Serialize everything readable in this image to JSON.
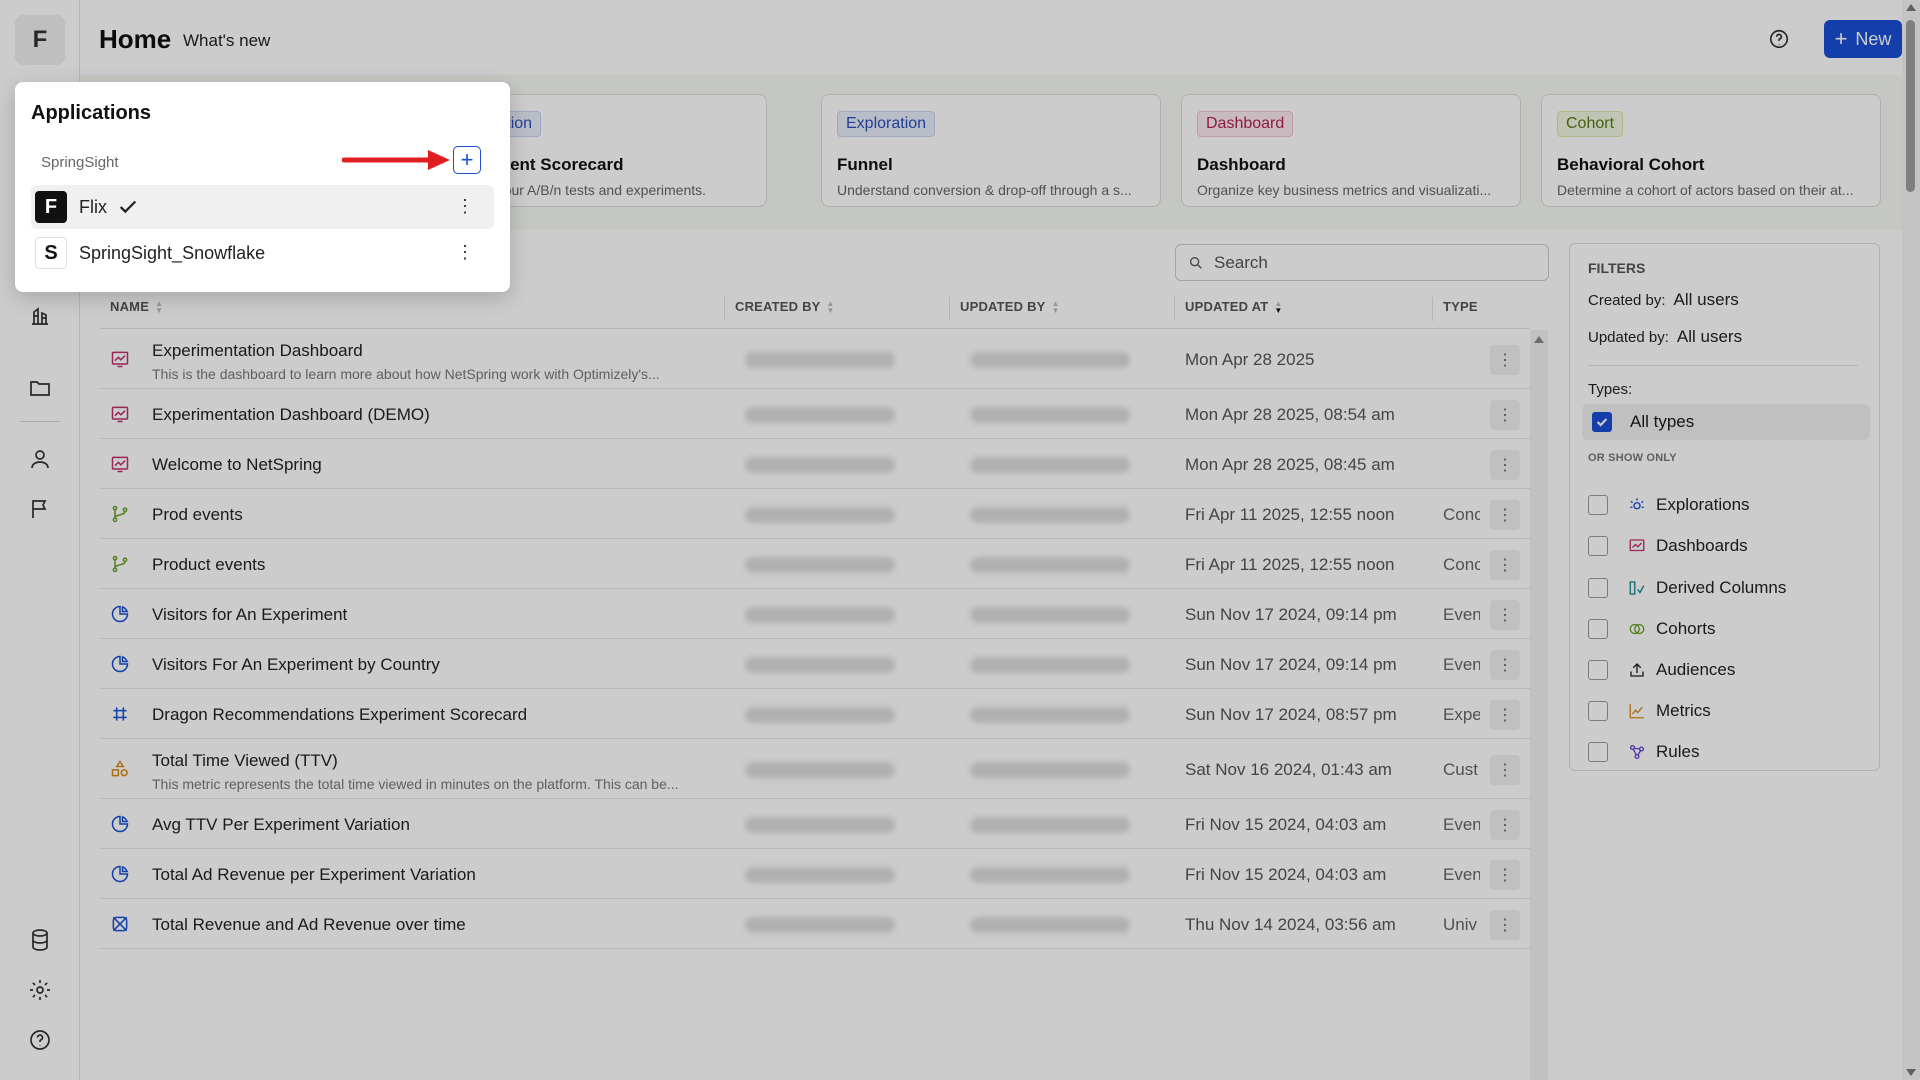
{
  "rail": {
    "logo_letter": "F",
    "icons": [
      "library-icon",
      "folder-icon",
      "user-icon",
      "flag-icon",
      "database-icon",
      "settings-icon",
      "help-icon"
    ]
  },
  "header": {
    "title": "Home",
    "subtitle": "What's new",
    "new_button": "New"
  },
  "templates": [
    {
      "badge": "Exploration",
      "badge_style": "explore",
      "title": "Experiment Scorecard",
      "desc": "Analyze your A/B/n tests and experiments."
    },
    {
      "badge": "Exploration",
      "badge_style": "explore",
      "title": "Funnel",
      "desc": "Understand conversion & drop-off through a s..."
    },
    {
      "badge": "Dashboard",
      "badge_style": "dash",
      "title": "Dashboard",
      "desc": "Organize key business metrics and visualizati..."
    },
    {
      "badge": "Cohort",
      "badge_style": "cohort",
      "title": "Behavioral Cohort",
      "desc": "Determine a cohort of actors based on their at..."
    }
  ],
  "search": {
    "placeholder": "Search"
  },
  "table": {
    "columns": {
      "name": "NAME",
      "created_by": "CREATED BY",
      "updated_by": "UPDATED BY",
      "updated_at": "UPDATED AT",
      "type": "TYPE"
    },
    "rows": [
      {
        "icon": "dashboard-icon",
        "name": "Experimentation Dashboard",
        "desc": "This is the dashboard to learn more about how NetSpring work with Optimizely's...",
        "updated_at": "Mon Apr 28 2025",
        "type": ""
      },
      {
        "icon": "dashboard-icon",
        "name": "Experimentation Dashboard (DEMO)",
        "desc": "",
        "updated_at": "Mon Apr 28 2025, 08:54 am",
        "type": ""
      },
      {
        "icon": "dashboard-icon",
        "name": "Welcome to NetSpring",
        "desc": "",
        "updated_at": "Mon Apr 28 2025, 08:45 am",
        "type": ""
      },
      {
        "icon": "branch-icon",
        "name": "Prod events",
        "desc": "",
        "updated_at": "Fri Apr 11 2025, 12:55 noon",
        "type": "Conc"
      },
      {
        "icon": "branch-icon",
        "name": "Product events",
        "desc": "",
        "updated_at": "Fri Apr 11 2025, 12:55 noon",
        "type": "Conc"
      },
      {
        "icon": "pie-chart-icon",
        "name": "Visitors for An Experiment",
        "desc": "",
        "updated_at": "Sun Nov 17 2024, 09:14 pm",
        "type": "Even"
      },
      {
        "icon": "pie-chart-icon",
        "name": "Visitors For An Experiment by Country",
        "desc": "",
        "updated_at": "Sun Nov 17 2024, 09:14 pm",
        "type": "Even"
      },
      {
        "icon": "scorecard-icon",
        "name": "Dragon Recommendations Experiment Scorecard",
        "desc": "",
        "updated_at": "Sun Nov 17 2024, 08:57 pm",
        "type": "Expe"
      },
      {
        "icon": "shapes-icon",
        "name": "Total Time Viewed (TTV)",
        "desc": "This metric represents the total time viewed in minutes on the platform. This can be...",
        "updated_at": "Sat Nov 16 2024, 01:43 am",
        "type": "Cust"
      },
      {
        "icon": "pie-chart-icon",
        "name": "Avg TTV Per Experiment Variation",
        "desc": "",
        "updated_at": "Fri Nov 15 2024, 04:03 am",
        "type": "Even"
      },
      {
        "icon": "pie-chart-icon",
        "name": "Total Ad Revenue per Experiment Variation",
        "desc": "",
        "updated_at": "Fri Nov 15 2024, 04:03 am",
        "type": "Even"
      },
      {
        "icon": "atom-icon",
        "name": "Total Revenue and Ad Revenue over time",
        "desc": "",
        "updated_at": "Thu Nov 14 2024, 03:56 am",
        "type": "Univ"
      }
    ]
  },
  "filters": {
    "title": "FILTERS",
    "created_by_label": "Created by:",
    "created_by_value": "All users",
    "updated_by_label": "Updated by:",
    "updated_by_value": "All users",
    "types_label": "Types:",
    "all_types": "All types",
    "or_show_only": "OR SHOW ONLY",
    "options": [
      {
        "label": "Explorations",
        "icon": "exploration-icon"
      },
      {
        "label": "Dashboards",
        "icon": "dashboard-icon"
      },
      {
        "label": "Derived Columns",
        "icon": "derived-column-icon"
      },
      {
        "label": "Cohorts",
        "icon": "cohort-icon"
      },
      {
        "label": "Audiences",
        "icon": "upload-icon"
      },
      {
        "label": "Metrics",
        "icon": "metric-icon"
      },
      {
        "label": "Rules",
        "icon": "rules-icon"
      }
    ]
  },
  "popover": {
    "title": "Applications",
    "group": "SpringSight",
    "items": [
      {
        "letter": "F",
        "name": "Flix",
        "selected": true
      },
      {
        "letter": "S",
        "name": "SpringSight_Snowflake",
        "selected": false
      }
    ]
  },
  "colors": {
    "accent": "#1a4fd6",
    "annotation_arrow": "#e02020"
  }
}
